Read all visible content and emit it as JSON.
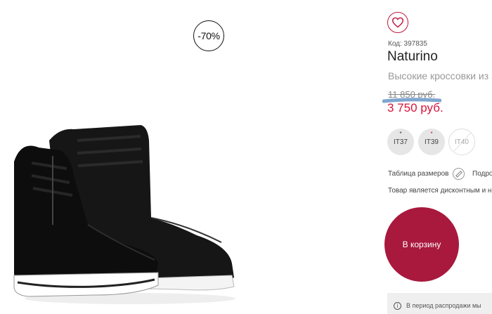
{
  "product": {
    "discount_badge": "-70%",
    "code": "Код: 397835",
    "brand": "Naturino",
    "subtitle": "Высокие кроссовки из к",
    "old_price": "11 850 руб.",
    "new_price": "3 750 руб."
  },
  "sizes": [
    {
      "label": "IT37",
      "available": true,
      "star": "*",
      "star_color": "#333333"
    },
    {
      "label": "IT39",
      "available": true,
      "star": "*",
      "star_color": "#d6133a"
    },
    {
      "label": "IT40",
      "available": false
    }
  ],
  "size_table": {
    "label": "Таблица размеров",
    "next_label": "Подро"
  },
  "note": "Товар является дисконтным и н",
  "cart_button": "В корзину",
  "info": {
    "text": "В период распродажи мы"
  },
  "colors": {
    "accent": "#d6133a",
    "cart": "#a8193d"
  }
}
